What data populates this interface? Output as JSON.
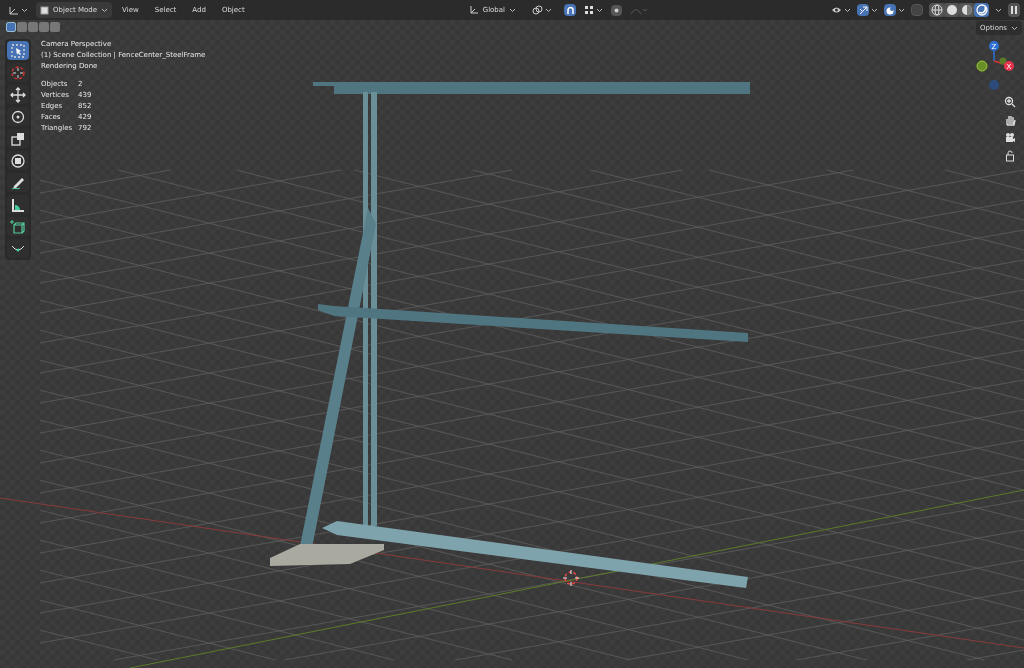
{
  "header": {
    "mode": "Object Mode",
    "menus": [
      "View",
      "Select",
      "Add",
      "Object"
    ],
    "transform_orientation": "Global",
    "options": "Options",
    "snap_on": true,
    "gizmos_on": true,
    "overlays_on": true
  },
  "selection_modes": [
    {
      "selected": true
    },
    {
      "selected": false
    },
    {
      "selected": false
    },
    {
      "selected": false
    },
    {
      "selected": false
    }
  ],
  "shading_modes": [
    {
      "kind": "wire",
      "selected": false
    },
    {
      "kind": "solid",
      "selected": false
    },
    {
      "kind": "material",
      "selected": false
    },
    {
      "kind": "rendered",
      "selected": true
    }
  ],
  "tools": [
    {
      "kind": "select",
      "selected": true
    },
    {
      "kind": "cursor",
      "selected": false
    },
    {
      "kind": "move",
      "selected": false
    },
    {
      "kind": "rotate",
      "selected": false
    },
    {
      "kind": "scale",
      "selected": false
    },
    {
      "kind": "transform",
      "selected": false
    },
    {
      "kind": "annotate",
      "selected": false
    },
    {
      "kind": "measure",
      "selected": false
    },
    {
      "kind": "addcube",
      "selected": false
    },
    {
      "kind": "curve",
      "selected": false
    }
  ],
  "overlay": {
    "lines": [
      "Camera Perspective",
      "(1) Scene Collection | FenceCenter_SteelFrame",
      "Rendering Done"
    ],
    "stats": [
      {
        "label": "Objects",
        "value": "2"
      },
      {
        "label": "Vertices",
        "value": "439"
      },
      {
        "label": "Edges",
        "value": "852"
      },
      {
        "label": "Faces",
        "value": "429"
      },
      {
        "label": "Triangles",
        "value": "792"
      }
    ]
  },
  "gizmo": {
    "z": "Z",
    "x": "X"
  }
}
